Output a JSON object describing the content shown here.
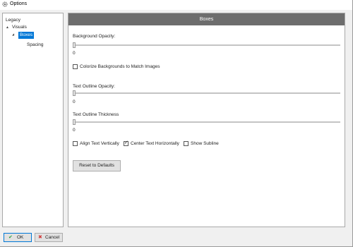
{
  "window": {
    "title": "Options"
  },
  "tree": {
    "items": [
      {
        "label": "Legacy"
      },
      {
        "label": "Visuals"
      },
      {
        "label": "Boxes"
      },
      {
        "label": "Spacing"
      }
    ]
  },
  "panel": {
    "header": "Boxes",
    "background_opacity": {
      "label": "Background Opacity:",
      "value": "0"
    },
    "colorize": {
      "label": "Colorize Backgrounds to Match Images",
      "checked": false
    },
    "text_outline_opacity": {
      "label": "Text Outline Opacity:",
      "value": "0"
    },
    "text_outline_thickness": {
      "label": "Text Outline Thickness",
      "value": "0"
    },
    "align_vertically": {
      "label": "Align Text Vertically",
      "checked": false
    },
    "center_horizontally": {
      "label": "Center Text Horizontally",
      "checked": true
    },
    "show_subline": {
      "label": "Show Subline",
      "checked": false
    },
    "reset_label": "Reset to Defaults"
  },
  "footer": {
    "ok_label": "OK",
    "ok_icon": "check-icon",
    "cancel_label": "Cancel",
    "cancel_icon": "x-icon"
  },
  "colors": {
    "selection": "#0078d7",
    "header_bar": "#6d6d6d",
    "ok_check": "#2e9e3e",
    "cancel_x": "#d03a3a"
  }
}
